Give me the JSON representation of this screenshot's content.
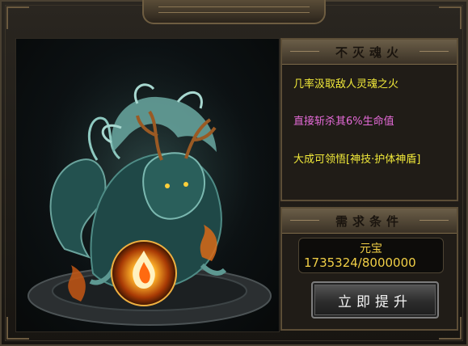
{
  "skill": {
    "title": "不灭魂火",
    "effects": [
      {
        "text": "几率汲取敌人灵魂之火",
        "color": "#f2ea3a"
      },
      {
        "text": "直接斩杀其6%生命值",
        "color": "#e66bd9"
      },
      {
        "text": "大成可领悟[神技·护体神盾]",
        "color": "#f2ea3a"
      }
    ]
  },
  "requirements": {
    "title": "需求条件",
    "currency_label": "元宝",
    "current": 1735324,
    "required": 8000000,
    "progress_text": "1735324/8000000",
    "progress_fraction": 0.217
  },
  "actions": {
    "upgrade_label": "立即提升"
  },
  "art": {
    "subject": "qilin-dragon-with-fire-orb",
    "orb_icon": "fire-orb-icon"
  }
}
